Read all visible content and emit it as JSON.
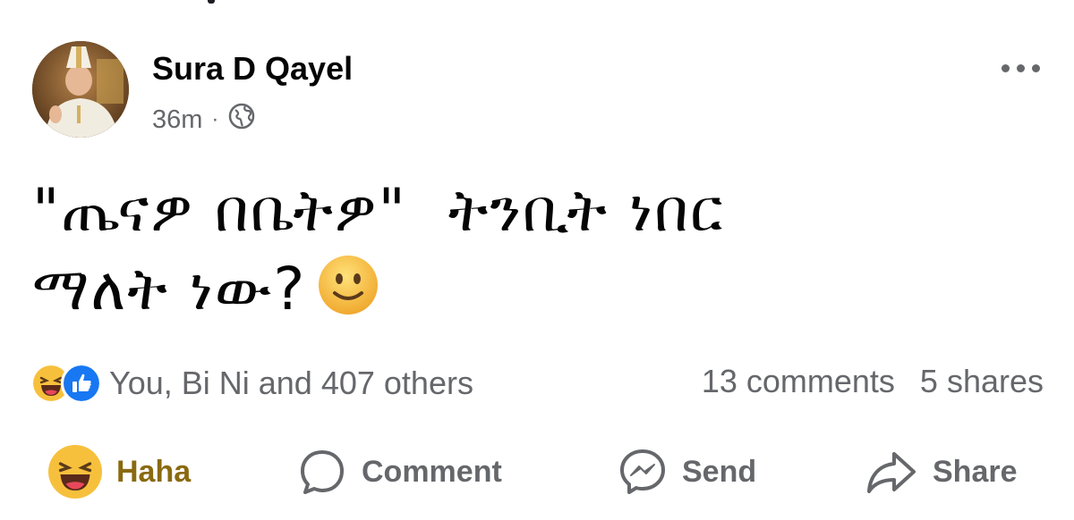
{
  "post": {
    "author": "Sura D Qayel",
    "time": "36m",
    "separator": "·",
    "audience_icon": "globe-icon",
    "text_line1": "\"ጤናዎ በቤትዎ\"  ትንቢት ነበር",
    "text_line2": "ማለት ነው?"
  },
  "stats": {
    "reactions_text": "You, Bi Ni and 407 others",
    "comments": "13 comments",
    "shares": "5 shares"
  },
  "actions": {
    "haha": "Haha",
    "comment": "Comment",
    "send": "Send",
    "share": "Share"
  },
  "colors": {
    "text": "#050505",
    "muted": "#65676b",
    "haha_label": "#8a6a10",
    "like_blue": "#1877f2",
    "emoji_yellow": "#f7c03c"
  }
}
